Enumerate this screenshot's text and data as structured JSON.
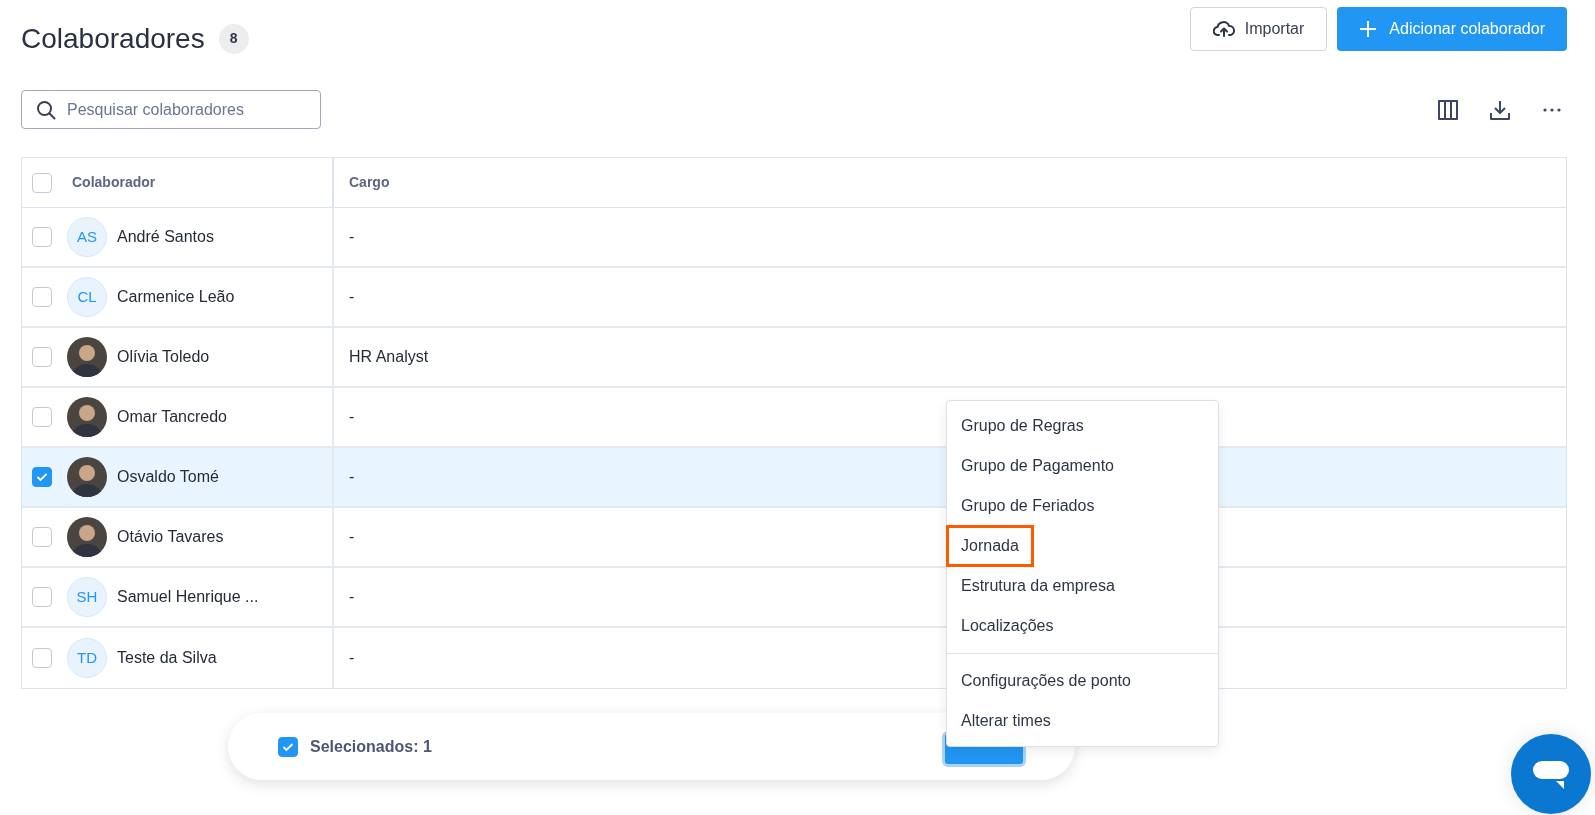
{
  "page": {
    "title": "Colaboradores",
    "count": "8"
  },
  "header_buttons": [
    {
      "kind": "import",
      "label": "Importar"
    },
    {
      "kind": "add",
      "label": "Adicionar colaborador"
    }
  ],
  "search": {
    "placeholder": "Pesquisar colaboradores"
  },
  "toolbar_icons": [
    {
      "kind": "columns"
    },
    {
      "kind": "download"
    },
    {
      "kind": "more"
    }
  ],
  "table": {
    "select_all": {
      "checked": false
    },
    "columns": [
      "Colaborador",
      "Cargo"
    ],
    "rows": [
      {
        "selected": false,
        "avatar": {
          "kind": "initials",
          "text": "AS"
        },
        "name": "André Santos",
        "cargo": "-"
      },
      {
        "selected": false,
        "avatar": {
          "kind": "initials",
          "text": "CL"
        },
        "name": "Carmenice Leão",
        "cargo": "-"
      },
      {
        "selected": false,
        "avatar": {
          "kind": "photo"
        },
        "name": "Olívia Toledo",
        "cargo": "HR Analyst"
      },
      {
        "selected": false,
        "avatar": {
          "kind": "photo"
        },
        "name": "Omar Tancredo",
        "cargo": "-"
      },
      {
        "selected": true,
        "avatar": {
          "kind": "photo"
        },
        "name": "Osvaldo Tomé",
        "cargo": "-"
      },
      {
        "selected": false,
        "avatar": {
          "kind": "photo"
        },
        "name": "Otávio Tavares",
        "cargo": "-"
      },
      {
        "selected": false,
        "avatar": {
          "kind": "initials",
          "text": "SH"
        },
        "name": "Samuel Henrique ...",
        "cargo": "-"
      },
      {
        "selected": false,
        "avatar": {
          "kind": "initials",
          "text": "TD"
        },
        "name": "Teste da Silva",
        "cargo": "-"
      }
    ]
  },
  "selection_bar": {
    "checked": true,
    "label": "Selecionados: 1"
  },
  "menu": {
    "groups": [
      [
        {
          "label": "Grupo de Regras",
          "highlighted": false
        },
        {
          "label": "Grupo de Pagamento",
          "highlighted": false
        },
        {
          "label": "Grupo de Feriados",
          "highlighted": false
        },
        {
          "label": "Jornada",
          "highlighted": true
        },
        {
          "label": "Estrutura da empresa",
          "highlighted": false
        },
        {
          "label": "Localizações",
          "highlighted": false
        }
      ],
      [
        {
          "label": "Configurações de ponto",
          "highlighted": false
        },
        {
          "label": "Alterar times",
          "highlighted": false
        }
      ]
    ]
  }
}
